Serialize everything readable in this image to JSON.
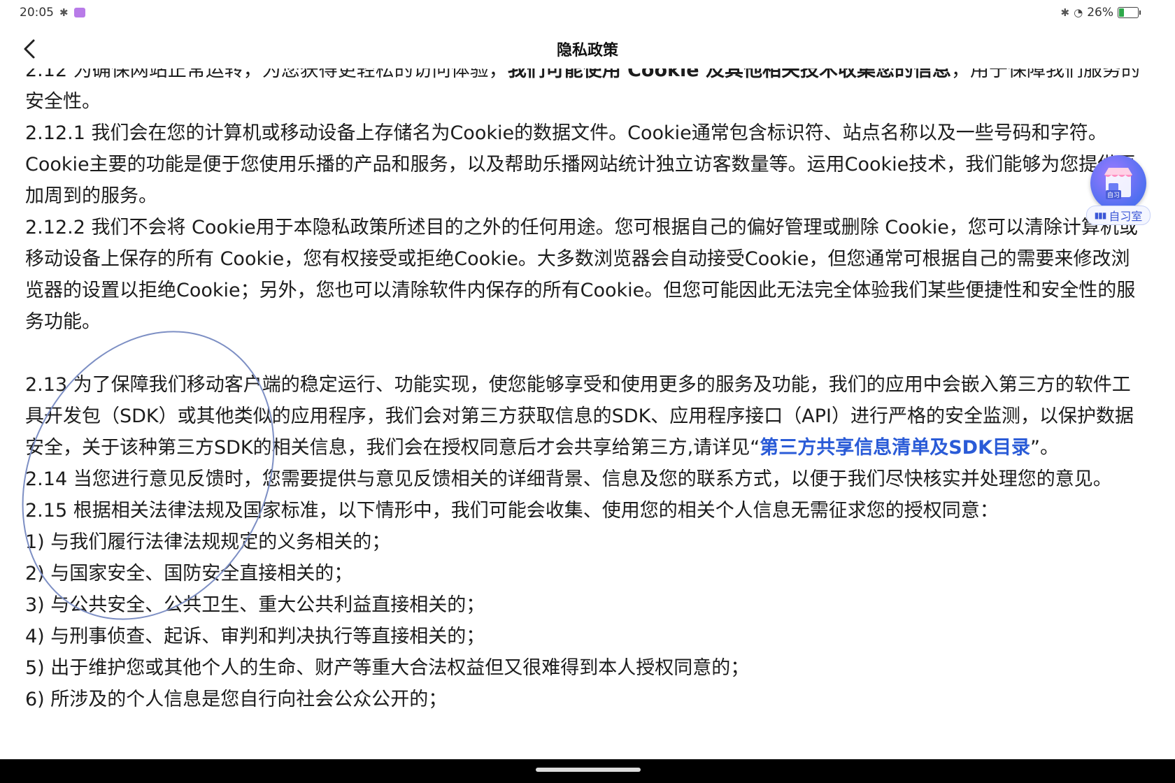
{
  "status_bar": {
    "time": "20:05",
    "battery_percent": "26%",
    "battery_level": 0.26,
    "icons": [
      "bluetooth-icon",
      "screen-record-icon",
      "wifi-icon",
      "battery-icon"
    ]
  },
  "nav": {
    "title": "隐私政策",
    "back_icon": "chevron-left-icon"
  },
  "article": {
    "partial_top": "2.12 为确保网站正常运转，为您获得更轻松的访问体验，",
    "partial_top_bold": "我们可能使用 Cookie 及其他相关技术收集您的信息",
    "partial_top_end": "，用于保障我们服务的安全性。",
    "p_2_12_1": "2.12.1 我们会在您的计算机或移动设备上存储名为Cookie的数据文件。Cookie通常包含标识符、站点名称以及一些号码和字符。Cookie主要的功能是便于您使用乐播的产品和服务，以及帮助乐播网站统计独立访客数量等。运用Cookie技术，我们能够为您提供更加周到的服务。",
    "p_2_12_2": "2.12.2 我们不会将 Cookie用于本隐私政策所述目的之外的任何用途。您可根据自己的偏好管理或删除 Cookie，您可以清除计算机或移动设备上保存的所有 Cookie，您有权接受或拒绝Cookie。大多数浏览器会自动接受Cookie，但您通常可根据自己的需要来修改浏览器的设置以拒绝Cookie；另外，您也可以清除软件内保存的所有Cookie。但您可能因此无法完全体验我们某些便捷性和安全性的服务功能。",
    "p_2_13": "2.13 为了保障我们移动客户端的稳定运行、功能实现，使您能够享受和使用更多的服务及功能，我们的应用中会嵌入第三方的软件工具开发包（SDK）或其他类似的应用程序，我们会对第三方获取信息的SDK、应用程序接口（API）进行严格的安全监测，以保护数据安全，关于该种第三方SDK的相关信息，我们会在授权同意后才会共享给第三方,请详见“",
    "p_2_13_link": "第三方共享信息清单及SDK目录",
    "p_2_13_end": "”。",
    "p_2_14": "2.14 当您进行意见反馈时，您需要提供与意见反馈相关的详细背景、信息及您的联系方式，以便于我们尽快核实并处理您的意见。",
    "p_2_15": "2.15 根据相关法律法规及国家标准，以下情形中，我们可能会收集、使用您的相关个人信息无需征求您的授权同意：",
    "list": [
      "1) 与我们履行法律法规规定的义务相关的；",
      "2) 与国家安全、国防安全直接相关的；",
      "3) 与公共安全、公共卫生、重大公共利益直接相关的；",
      "4) 与刑事侦查、起诉、审判和判决执行等直接相关的；",
      "5) 出于维护您或其他个人的生命、财产等重大合法权益但又很难得到本人授权同意的；",
      "6) 所涉及的个人信息是您自行向社会公众公开的；"
    ]
  },
  "float_widget": {
    "label": "自习室",
    "badge": "自习",
    "icon": "study-room-store-icon"
  },
  "colors": {
    "link": "#2a5bd7",
    "annotation_ellipse": "#7d8fc4",
    "widget": "#5b6ef0"
  }
}
